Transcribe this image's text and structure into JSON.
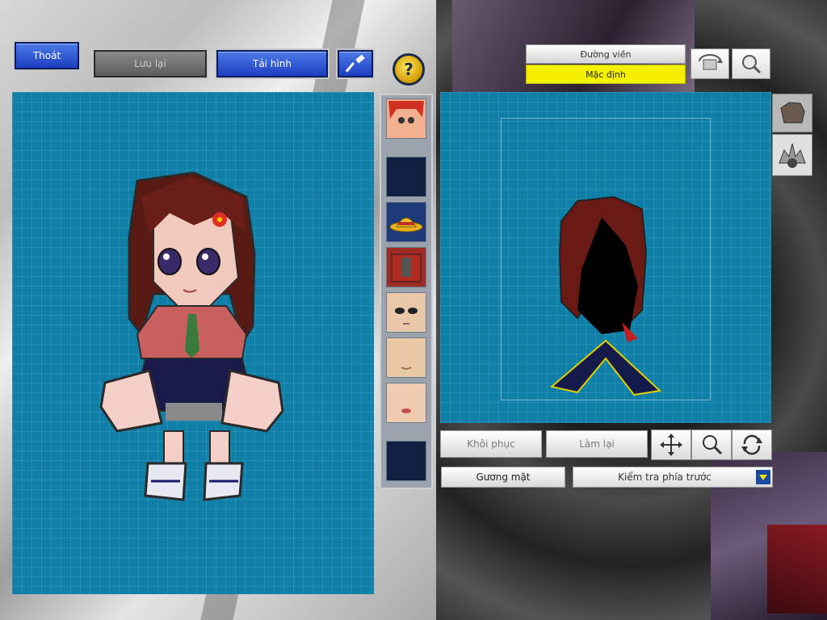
{
  "toolbar": {
    "exit_label": "Thoát",
    "save_label": "Lưu lại",
    "reload_label": "Tải hình"
  },
  "top_right": {
    "outline_label": "Đường viền",
    "default_label": "Mặc định"
  },
  "edit_controls": {
    "restore_label": "Khôi phục",
    "redo_label": "Làm lại",
    "face_label": "Gương mặt",
    "view_select_value": "Kiểm tra phía trước"
  },
  "colors": {
    "grid_bg": "#0f7fa8",
    "default_highlight": "#f5f000",
    "button_blue": "#2a52d0"
  },
  "icons": {
    "hammer": "hammer-icon",
    "help": "help-icon",
    "move": "move-icon",
    "zoom": "zoom-icon",
    "rotate": "rotate-icon"
  }
}
